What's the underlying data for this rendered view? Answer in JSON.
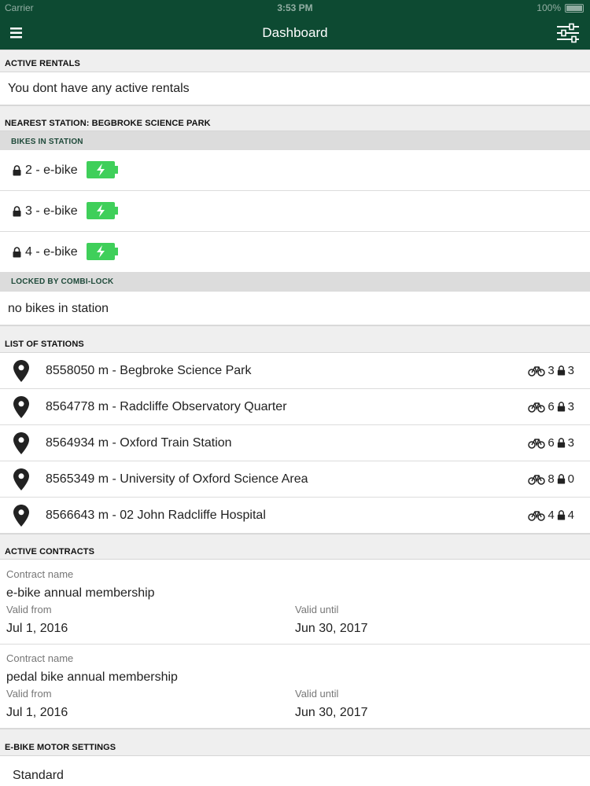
{
  "status_bar": {
    "carrier": "Carrier",
    "time": "3:53 PM",
    "battery": "100%"
  },
  "nav": {
    "title": "Dashboard",
    "menu_icon": "hamburger-menu-icon",
    "filter_icon": "sliders-icon"
  },
  "active_rentals": {
    "header": "ACTIVE RENTALS",
    "message": "You dont have any active rentals"
  },
  "nearest_station": {
    "header": "NEAREST STATION: BEGBROKE SCIENCE PARK",
    "bikes_header": "BIKES IN STATION",
    "bikes": [
      {
        "label": "2 - e-bike",
        "icon": "lock-icon",
        "battery_icon": "charging-battery-icon"
      },
      {
        "label": "3 - e-bike",
        "icon": "lock-icon",
        "battery_icon": "charging-battery-icon"
      },
      {
        "label": "4 - e-bike",
        "icon": "lock-icon",
        "battery_icon": "charging-battery-icon"
      }
    ],
    "combi_header": "LOCKED BY COMBI-LOCK",
    "combi_message": "no bikes in station"
  },
  "stations": {
    "header": "LIST OF STATIONS",
    "items": [
      {
        "label": "8558050 m - Begbroke Science Park",
        "bikes": "3",
        "locks": "3"
      },
      {
        "label": "8564778 m - Radcliffe Observatory Quarter",
        "bikes": "6",
        "locks": "3"
      },
      {
        "label": "8564934 m - Oxford Train Station",
        "bikes": "6",
        "locks": "3"
      },
      {
        "label": "8565349 m - University of Oxford Science Area",
        "bikes": "8",
        "locks": "0"
      },
      {
        "label": "8566643 m - 02 John Radcliffe Hospital",
        "bikes": "4",
        "locks": "4"
      }
    ]
  },
  "contracts": {
    "header": "ACTIVE CONTRACTS",
    "items": [
      {
        "name_label": "Contract name",
        "name": "e-bike annual membership",
        "from_label": "Valid from",
        "from": "Jul 1, 2016",
        "until_label": "Valid until",
        "until": "Jun 30, 2017"
      },
      {
        "name_label": "Contract name",
        "name": "pedal bike annual membership",
        "from_label": "Valid from",
        "from": "Jul 1, 2016",
        "until_label": "Valid until",
        "until": "Jun 30, 2017"
      }
    ]
  },
  "motor": {
    "header": "E-BIKE MOTOR SETTINGS",
    "value": "Standard"
  },
  "colors": {
    "brand": "#0d4a32",
    "battery_green": "#3fcf5a"
  }
}
